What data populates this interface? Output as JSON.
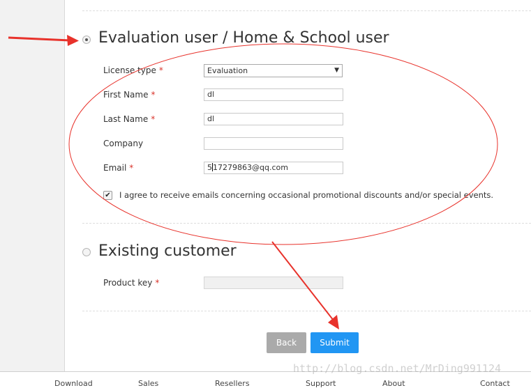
{
  "evaluation": {
    "title": "Evaluation user / Home & School user",
    "selected": true,
    "fields": {
      "license_type": {
        "label": "License type",
        "value": "Evaluation"
      },
      "first_name": {
        "label": "First Name",
        "value": "dl"
      },
      "last_name": {
        "label": "Last Name",
        "value": "dl"
      },
      "company": {
        "label": "Company",
        "value": ""
      },
      "email": {
        "label": "Email",
        "value_before_cursor": "5",
        "value_after_cursor": "17279863@qq.com"
      }
    },
    "required_marker": "*",
    "agree_checked": true,
    "agree_text": "I agree to receive emails concerning occasional promotional discounts and/or special events."
  },
  "existing": {
    "title": "Existing customer",
    "selected": false,
    "product_key": {
      "label": "Product key",
      "value": ""
    }
  },
  "buttons": {
    "back": "Back",
    "submit": "Submit"
  },
  "footer": {
    "links": [
      "Download",
      "Sales",
      "Resellers",
      "Support",
      "About",
      "Contact"
    ]
  },
  "watermark": "http://blog.csdn.net/MrDing991124",
  "colors": {
    "accent": "#2196f3",
    "annotation": "#e8322b",
    "required": "#d9342b"
  }
}
